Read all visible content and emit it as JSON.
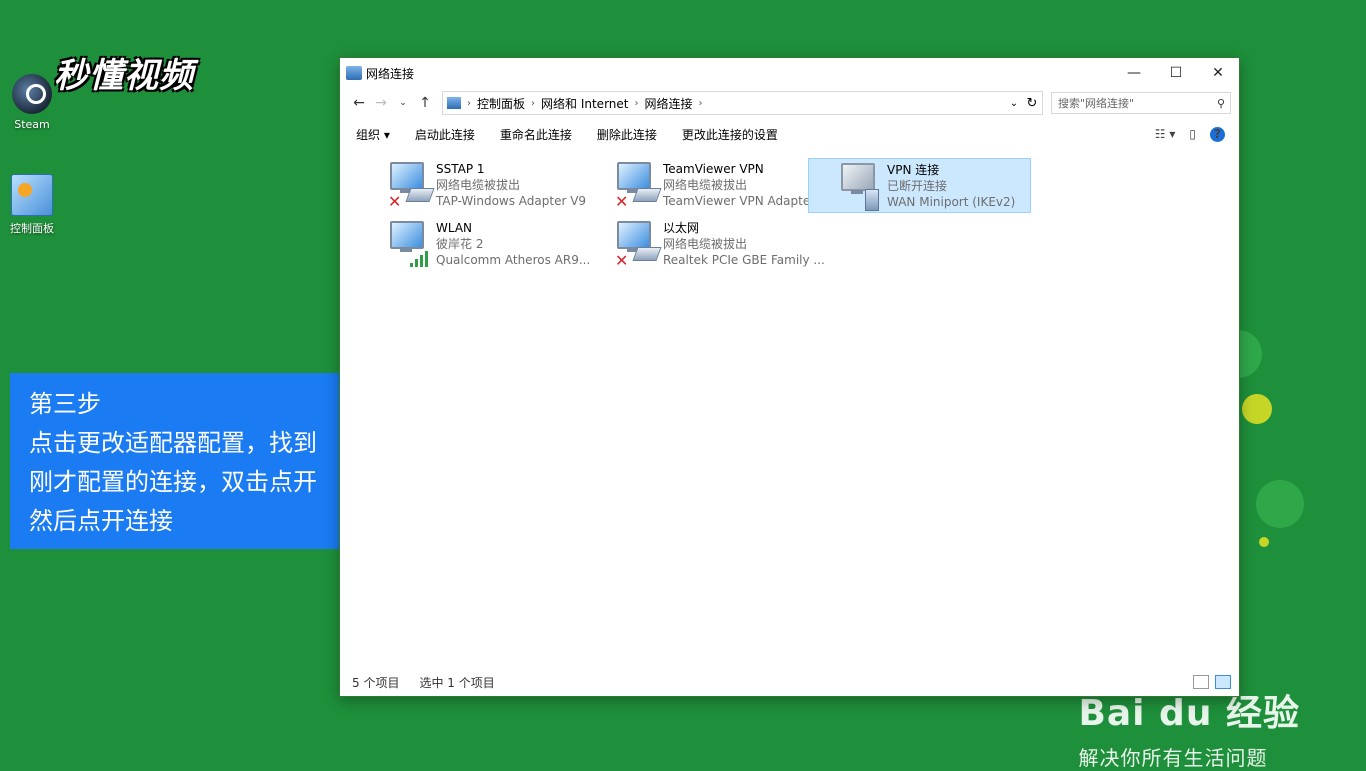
{
  "desktop": {
    "icons": [
      {
        "label": "Steam"
      },
      {
        "label": "控制面板"
      }
    ],
    "watermark": "秒懂视频"
  },
  "instruction": {
    "lines": [
      "第三步",
      "点击更改适配器配置，找到",
      "刚才配置的连接，双击点开",
      "然后点开连接"
    ]
  },
  "brand": {
    "logo": "Bai du 经验",
    "tagline": "解决你所有生活问题"
  },
  "window": {
    "title": "网络连接",
    "controls": {
      "minimize": "—",
      "maximize": "☐",
      "close": "✕"
    },
    "breadcrumb": [
      "控制面板",
      "网络和 Internet",
      "网络连接"
    ],
    "search_placeholder": "搜索\"网络连接\"",
    "toolbar": [
      "组织 ▾",
      "启动此连接",
      "重命名此连接",
      "删除此连接",
      "更改此连接的设置"
    ],
    "connections": [
      {
        "name": "SSTAP 1",
        "status": "网络电缆被拔出",
        "adapter": "TAP-Windows Adapter V9",
        "icon": "ethernet-disconnected-icon"
      },
      {
        "name": "TeamViewer VPN",
        "status": "网络电缆被拔出",
        "adapter": "TeamViewer VPN Adapter",
        "icon": "ethernet-disconnected-icon"
      },
      {
        "name": "VPN 连接",
        "status": "已断开连接",
        "adapter": "WAN Miniport (IKEv2)",
        "icon": "vpn-connection-icon",
        "selected": true
      },
      {
        "name": "WLAN",
        "status": "彼岸花 2",
        "adapter": "Qualcomm Atheros AR9...",
        "icon": "wifi-connected-icon"
      },
      {
        "name": "以太网",
        "status": "网络电缆被拔出",
        "adapter": "Realtek PCIe GBE Family ...",
        "icon": "ethernet-disconnected-icon"
      }
    ],
    "status": {
      "count": "5 个项目",
      "selected": "选中 1 个项目"
    }
  },
  "colors": {
    "desktop": "#1e8f3a",
    "step_box": "#1a7bf2",
    "selection": "#cce8ff"
  }
}
